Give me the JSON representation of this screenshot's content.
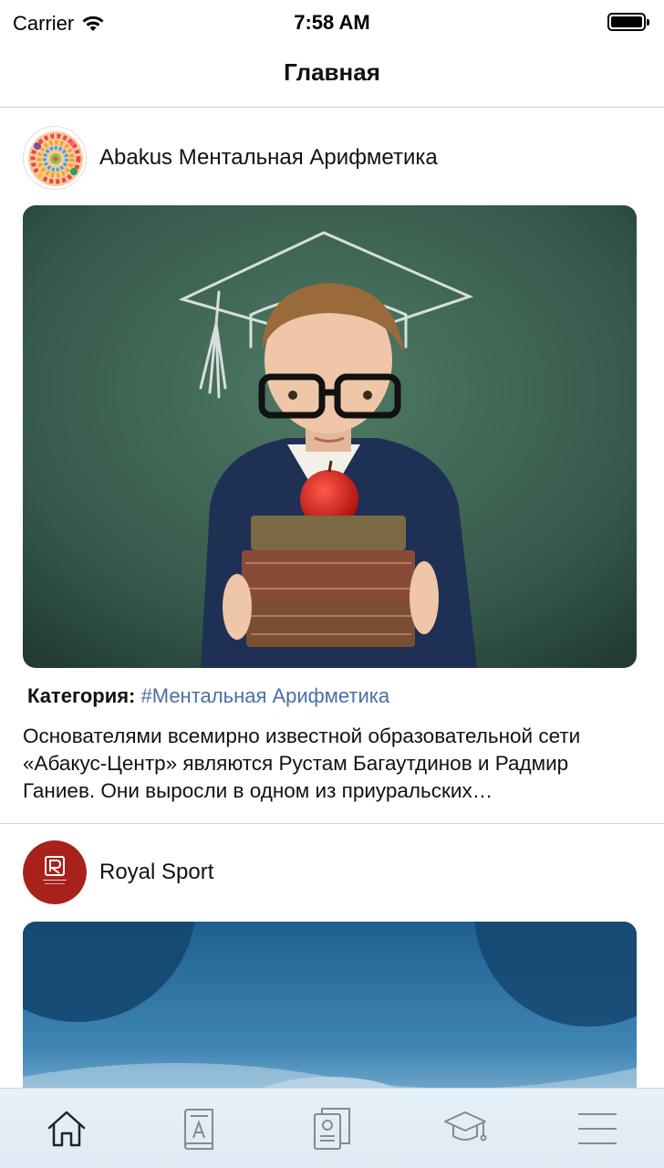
{
  "status_bar": {
    "carrier": "Carrier",
    "time": "7:58 AM"
  },
  "nav": {
    "title": "Главная"
  },
  "posts": [
    {
      "author": "Abakus Ментальная Арифметика",
      "category_label": "Категория:",
      "category_tag": "#Ментальная Арифметика",
      "text": "Основателями всемирно известной образовательной сети «Абакус-Центр» являются Рустам Багаутдинов и Радмир Ганиев. Они выросли в одном из приуральских…"
    },
    {
      "author": "Royal Sport"
    }
  ],
  "tabs": [
    {
      "icon": "home-icon",
      "active": true
    },
    {
      "icon": "book-icon",
      "active": false
    },
    {
      "icon": "documents-icon",
      "active": false
    },
    {
      "icon": "graduation-cap-icon",
      "active": false
    },
    {
      "icon": "menu-icon",
      "active": false
    }
  ],
  "colors": {
    "tag": "#4a6fa5",
    "tab_active": "#222222",
    "tab_inactive": "#8a8a8a",
    "tabbar_bg": "#e3edf6"
  }
}
